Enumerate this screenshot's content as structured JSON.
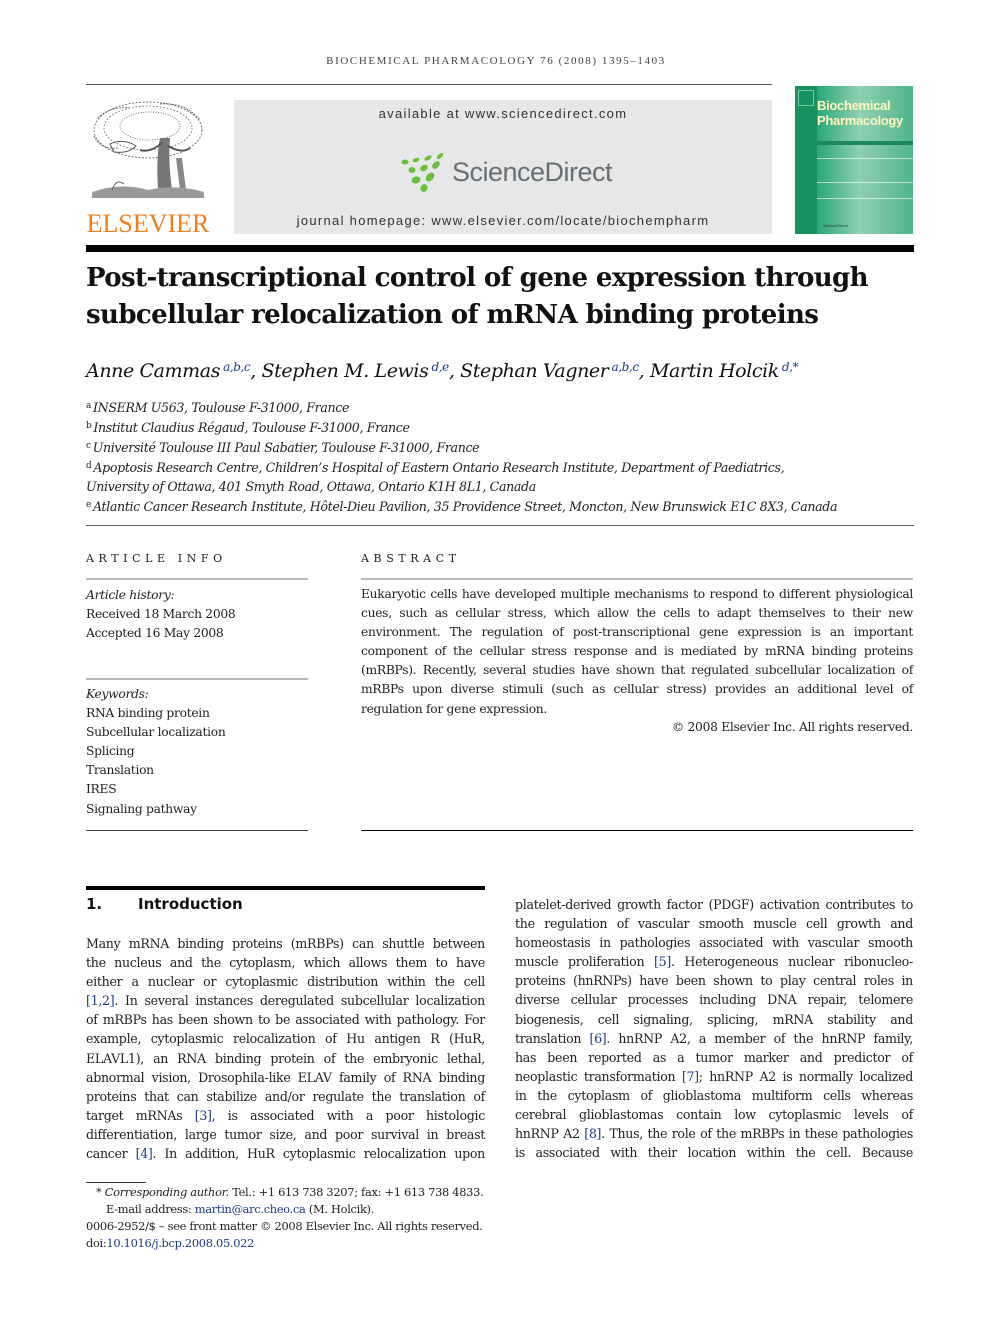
{
  "running_header": "BIOCHEMICAL PHARMACOLOGY 76 (2008) 1395–1403",
  "masthead": {
    "publisher_logo": "ELSEVIER",
    "available_at": "available at www.sciencedirect.com",
    "sciencedirect_logo": "ScienceDirect",
    "journal_homepage": "journal homepage: www.elsevier.com/locate/biochempharm",
    "cover_title_line1": "Biochemical",
    "cover_title_line2": "Pharmacology",
    "cover_footer": "ScienceDirect",
    "colors": {
      "elsevier_orange": "#f07e1f",
      "sciencedirect_green": "#6bbf3b",
      "cover_green": "#1e9a66"
    }
  },
  "article": {
    "title": "Post-transcriptional control of gene expression through subcellular relocalization of mRNA binding proteins",
    "authors": [
      {
        "name": "Anne Cammas",
        "affil": "a,b,c",
        "sep": ", "
      },
      {
        "name": "Stephen M. Lewis",
        "affil": "d,e",
        "sep": ", "
      },
      {
        "name": "Stephan Vagner",
        "affil": "a,b,c",
        "sep": ", "
      },
      {
        "name": "Martin Holcik",
        "affil": "d,*",
        "sep": ""
      }
    ],
    "affiliations": [
      {
        "key": "a",
        "text": "INSERM U563, Toulouse F-31000, France"
      },
      {
        "key": "b",
        "text": "Institut Claudius Régaud, Toulouse F-31000, France"
      },
      {
        "key": "c",
        "text": "Université Toulouse III Paul Sabatier, Toulouse F-31000, France"
      },
      {
        "key": "d",
        "text": "Apoptosis Research Centre, Children’s Hospital of Eastern Ontario Research Institute, Department of Paediatrics,",
        "cont": "University of Ottawa, 401 Smyth Road, Ottawa, Ontario K1H 8L1, Canada"
      },
      {
        "key": "e",
        "text": "Atlantic Cancer Research Institute, Hôtel-Dieu Pavilion, 35 Providence Street, Moncton, New Brunswick E1C 8X3, Canada"
      }
    ]
  },
  "article_info": {
    "heading": "ARTICLE INFO",
    "history_label": "Article history:",
    "received": "Received 18 March 2008",
    "accepted": "Accepted 16 May 2008",
    "keywords_label": "Keywords:",
    "keywords": [
      "RNA binding protein",
      "Subcellular localization",
      "Splicing",
      "Translation",
      "IRES",
      "Signaling pathway"
    ]
  },
  "abstract": {
    "heading": "ABSTRACT",
    "text": "Eukaryotic cells have developed multiple mechanisms to respond to different physiological cues, such as cellular stress, which allow the cells to adapt themselves to their new environment. The regulation of post-transcriptional gene expression is an important component of the cellular stress response and is mediated by mRNA binding proteins (mRBPs). Recently, several studies have shown that regulated subcellular localization of mRBPs upon diverse stimuli (such as cellular stress) provides an additional level of regulation for gene expression.",
    "copyright": "© 2008 Elsevier Inc. All rights reserved."
  },
  "introduction": {
    "number": "1.",
    "heading": "Introduction",
    "left_lines": [
      "Many mRNA binding proteins (mRBPs) can shuttle between",
      "the nucleus and the cytoplasm, which allows them to have",
      "either a nuclear or cytoplasmic distribution within the cell",
      [
        "[1,2]",
        ". In several instances deregulated subcellular localization"
      ],
      "of mRBPs has been shown to be associated with pathology. For",
      "example, cytoplasmic relocalization of Hu antigen R (HuR,",
      "ELAVL1), an RNA binding protein of the embryonic lethal,",
      "abnormal vision, Drosophila-like ELAV family of RNA binding",
      "proteins that can stabilize and/or regulate the translation of",
      [
        "target mRNAs ",
        "[3]",
        ", is associated with a poor histologic"
      ],
      "differentiation, large tumor size, and poor survival in breast",
      [
        "cancer ",
        "[4]",
        ". In addition, HuR cytoplasmic relocalization upon"
      ]
    ],
    "right_lines": [
      "platelet-derived growth factor (PDGF) activation contributes to",
      "the regulation of vascular smooth muscle cell growth and",
      "homeostasis in pathologies associated with vascular smooth",
      [
        "muscle proliferation ",
        "[5]",
        ". Heterogeneous nuclear ribonucleo-"
      ],
      "proteins (hnRNPs) have been shown to play central roles in",
      "diverse cellular processes including DNA repair, telomere",
      "biogenesis, cell signaling, splicing, mRNA stability and",
      [
        "translation ",
        "[6]",
        ". hnRNP A2, a member of the hnRNP family,"
      ],
      "has been reported as a tumor marker and predictor of",
      [
        "neoplastic transformation ",
        "[7]",
        "; hnRNP A2 is normally localized"
      ],
      "in the cytoplasm of glioblastoma multiform cells whereas",
      "cerebral glioblastomas contain low cytoplasmic levels of",
      [
        "hnRNP A2 ",
        "[8]",
        ". Thus, the role of the mRBPs in these pathologies"
      ],
      "is associated with their location within the cell. Because"
    ]
  },
  "footnotes": {
    "corresponding_star": "*",
    "corresponding_label": "Corresponding author.",
    "corresponding_contact": " Tel.: +1 613 738 3207; fax: +1 613 738 4833.",
    "email_label": "E-mail address: ",
    "email": "martin@arc.cheo.ca",
    "email_name": " (M. Holcik).",
    "issn_line": "0006-2952/$ – see front matter © 2008 Elsevier Inc. All rights reserved.",
    "doi_label": "doi:",
    "doi": "10.1016/j.bcp.2008.05.022"
  }
}
